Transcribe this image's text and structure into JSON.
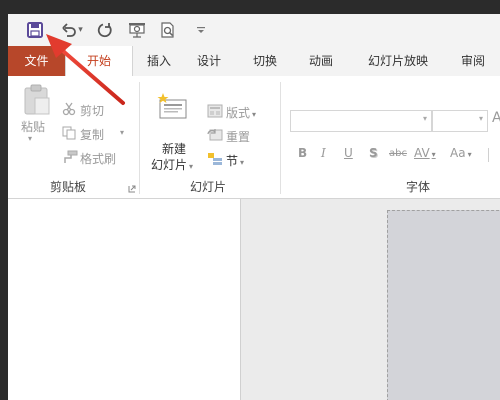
{
  "quick_access": {
    "save_icon": "save-icon",
    "undo_icon": "undo-icon",
    "redo_icon": "repeat-icon",
    "present_icon": "start-from-beginning-icon",
    "preview_icon": "print-preview-icon",
    "customize_icon": "customize-toolbar-icon"
  },
  "tabs": {
    "file": "文件",
    "home": "开始",
    "insert": "插入",
    "design": "设计",
    "transitions": "切换",
    "animations": "动画",
    "slideshow": "幻灯片放映",
    "review": "审阅"
  },
  "clipboard": {
    "paste": "粘贴",
    "cut": "剪切",
    "copy": "复制",
    "format_painter": "格式刷",
    "group_label": "剪贴板"
  },
  "slides": {
    "new_slide_line1": "新建",
    "new_slide_line2": "幻灯片",
    "layout": "版式",
    "reset": "重置",
    "section": "节",
    "group_label": "幻灯片"
  },
  "font": {
    "bold": "B",
    "italic": "I",
    "underline": "U",
    "shadow": "S",
    "strikethrough": "abc",
    "spacing": "AV",
    "change_case": "Aa",
    "grow": "A",
    "group_label": "字体"
  },
  "colors": {
    "accent": "#b7472a",
    "active_tab_text": "#c43e1c",
    "annotation_arrow": "#e23b2e",
    "slide_fill": "#d3d4d9"
  }
}
